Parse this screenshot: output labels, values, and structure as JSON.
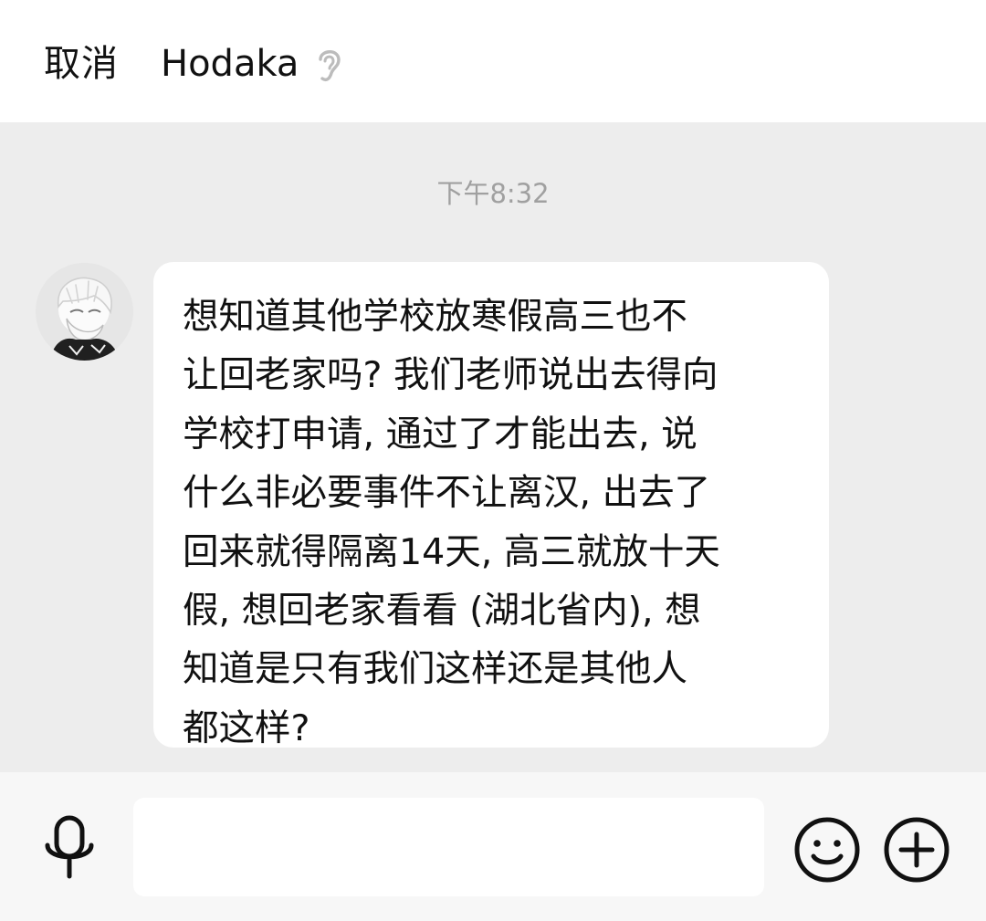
{
  "header": {
    "cancel_label": "取消",
    "contact_name": "Hodaka",
    "earpiece_icon": "ear-icon"
  },
  "chat": {
    "timestamp": "下午8:32",
    "messages": [
      {
        "sender_avatar": "avatar",
        "text": "想知道其他学校放寒假高三也不\n让回老家吗? 我们老师说出去得向\n学校打申请, 通过了才能出去, 说\n什么非必要事件不让离汉, 出去了\n回来就得隔离14天, 高三就放十天\n假, 想回老家看看 (湖北省内), 想\n知道是只有我们这样还是其他人\n都这样?"
      }
    ]
  },
  "input_bar": {
    "mic_icon": "microphone-icon",
    "input_value": "",
    "emoji_icon": "smiley-icon",
    "plus_icon": "plus-icon"
  },
  "colors": {
    "chat_background": "#ededed",
    "bubble_background": "#ffffff",
    "timestamp_text": "#a0a0a0"
  }
}
